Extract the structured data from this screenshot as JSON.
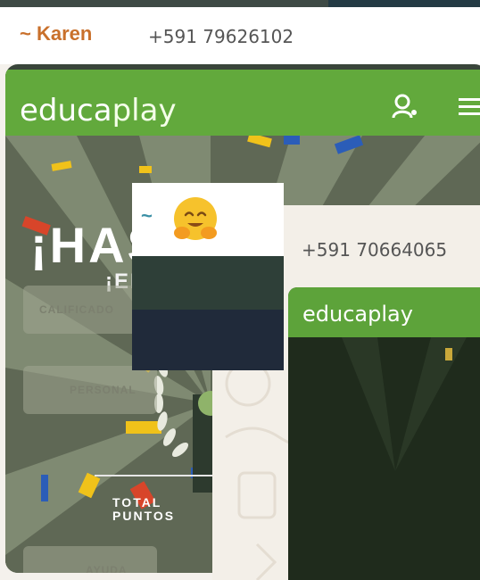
{
  "message1": {
    "sender": "~ Karen",
    "phone": "+591 79626102"
  },
  "screenshot1": {
    "logo_bold": "educa",
    "logo_thin": "play",
    "title": "¡HAS G",
    "subtitle": "¡ENHO",
    "panels": [
      "CALIFICADO",
      "PERSONAL",
      "AYUDA"
    ],
    "total_label": "TOTAL\nPUNTOS"
  },
  "message2": {
    "phone": "+591 70664065",
    "logo_bold": "educa",
    "logo_thin": "play"
  },
  "message3": {
    "tilde": "~",
    "emoji": "hugging-face"
  },
  "colors": {
    "sender": "#c9702b",
    "educaplay_green": "#62a93c",
    "tilde": "#3a8fa5"
  }
}
